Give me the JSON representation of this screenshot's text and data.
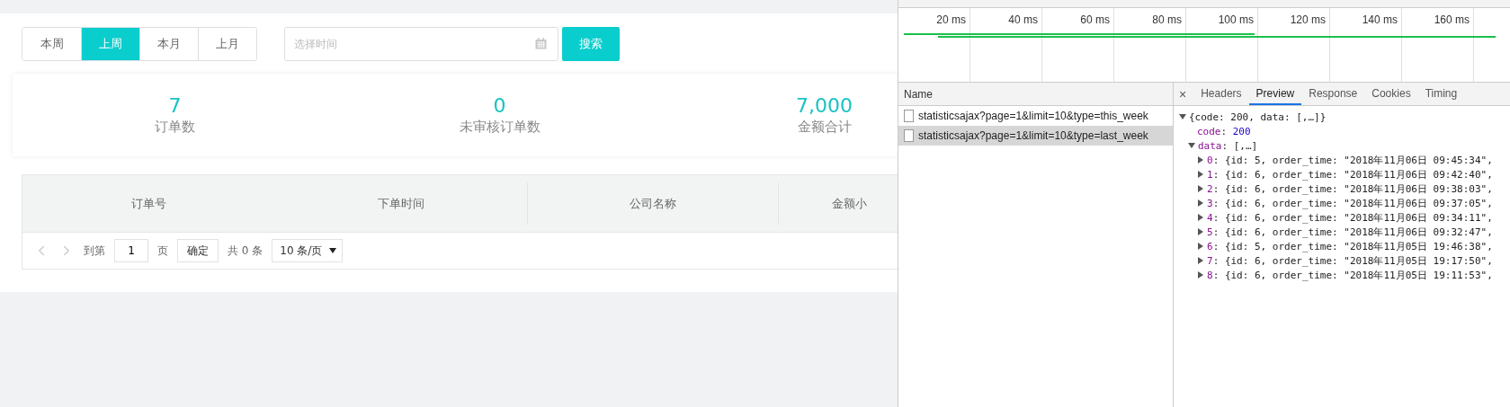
{
  "period_tabs": [
    {
      "label": "本周",
      "selected": false
    },
    {
      "label": "上周",
      "selected": true
    },
    {
      "label": "本月",
      "selected": false
    },
    {
      "label": "上月",
      "selected": false
    }
  ],
  "date_field": {
    "placeholder": "选择时间"
  },
  "search_button": "搜索",
  "stats": [
    {
      "value": "7",
      "label": "订单数"
    },
    {
      "value": "0",
      "label": "未审核订单数"
    },
    {
      "value": "7,000",
      "label": "金额合计"
    }
  ],
  "table": {
    "columns": [
      "订单号",
      "下单时间",
      "公司名称",
      "金额小"
    ]
  },
  "pagination": {
    "goto_label": "到第",
    "page": "1",
    "page_unit": "页",
    "confirm": "确定",
    "total": "共 0 条",
    "page_size": "10 条/页"
  },
  "devtools": {
    "timeline_ticks": [
      "20 ms",
      "40 ms",
      "60 ms",
      "80 ms",
      "100 ms",
      "120 ms",
      "140 ms",
      "160 ms"
    ],
    "requests_header": "Name",
    "requests": [
      {
        "name": "statisticsajax?page=1&limit=10&type=this_week",
        "selected": false
      },
      {
        "name": "statisticsajax?page=1&limit=10&type=last_week",
        "selected": true
      }
    ],
    "close": "×",
    "tabs": [
      {
        "label": "Headers",
        "selected": false
      },
      {
        "label": "Preview",
        "selected": true
      },
      {
        "label": "Response",
        "selected": false
      },
      {
        "label": "Cookies",
        "selected": false
      },
      {
        "label": "Timing",
        "selected": false
      }
    ],
    "preview": {
      "separator": ": ",
      "root": "{code: 200, data: [,…]}",
      "root_expanded": true,
      "code_key": "code",
      "code_value": "200",
      "data_key": "data",
      "data_summary": "[,…]",
      "data_expanded": true,
      "items": [
        {
          "index": "0",
          "text": "{id: 5, order_time: \"2018年11月06日 09:45:34\","
        },
        {
          "index": "1",
          "text": "{id: 6, order_time: \"2018年11月06日 09:42:40\","
        },
        {
          "index": "2",
          "text": "{id: 6, order_time: \"2018年11月06日 09:38:03\","
        },
        {
          "index": "3",
          "text": "{id: 6, order_time: \"2018年11月06日 09:37:05\","
        },
        {
          "index": "4",
          "text": "{id: 6, order_time: \"2018年11月06日 09:34:11\","
        },
        {
          "index": "5",
          "text": "{id: 6, order_time: \"2018年11月06日 09:32:47\","
        },
        {
          "index": "6",
          "text": "{id: 5, order_time: \"2018年11月05日 19:46:38\","
        },
        {
          "index": "7",
          "text": "{id: 6, order_time: \"2018年11月05日 19:17:50\","
        },
        {
          "index": "8",
          "text": "{id: 6, order_time: \"2018年11月05日 19:11:53\","
        }
      ]
    }
  }
}
